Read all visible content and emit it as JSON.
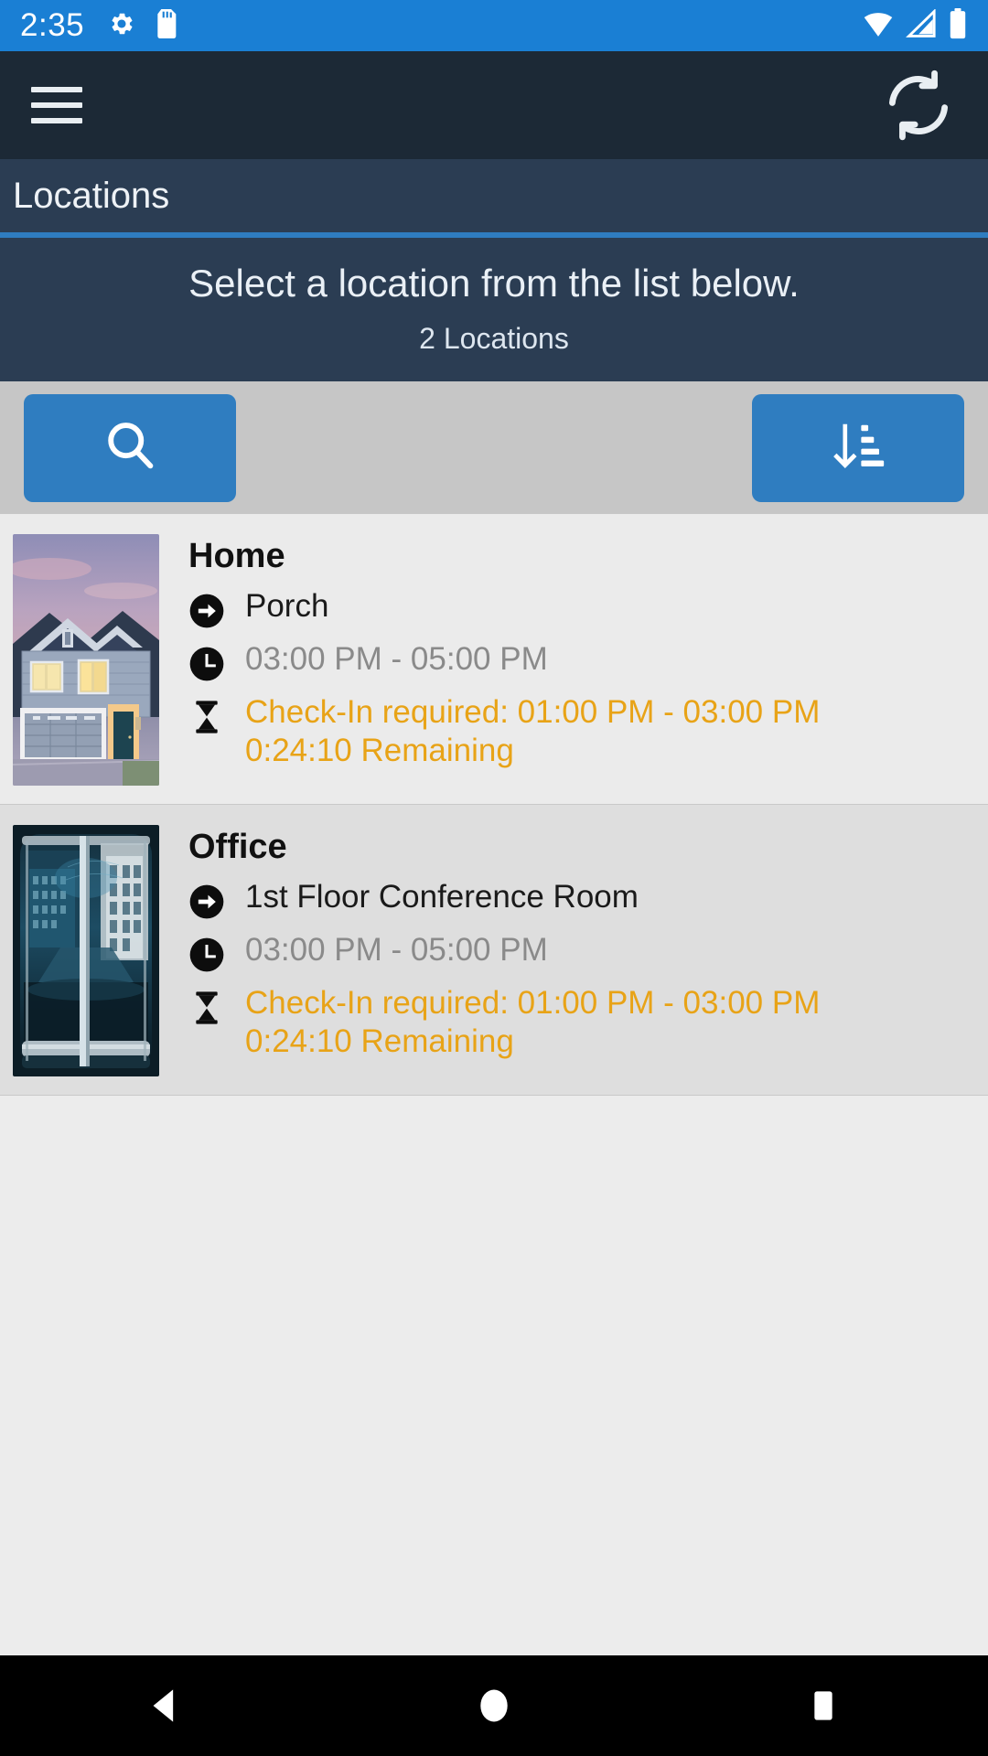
{
  "status_bar": {
    "time": "2:35",
    "left_icons": [
      "gear-icon",
      "sd-card-icon"
    ],
    "right_icons": [
      "wifi-icon",
      "cell-signal-icon",
      "battery-icon"
    ],
    "background_color": "#1a7fd4"
  },
  "app_bar": {
    "menu_icon": "hamburger-menu-icon",
    "refresh_icon": "sync-refresh-icon",
    "background_color": "#1c2936"
  },
  "header": {
    "title": "Locations",
    "accent_color": "#2f7dc0",
    "background_color": "#2b3d53"
  },
  "instruction": {
    "primary": "Select a location from the list below.",
    "count": "2 Locations"
  },
  "toolbar": {
    "search_label": "search-icon",
    "sort_label": "sort-descending-icon",
    "button_color": "#2f7dc0",
    "background_color": "#c6c6c6"
  },
  "locations": [
    {
      "name": "Home",
      "thumbnail": "house-at-dusk-photo",
      "place_icon": "arrow-circle-right-icon",
      "place": "Porch",
      "time_icon": "clock-icon",
      "time_range": "03:00 PM - 05:00 PM",
      "checkin_icon": "hourglass-icon",
      "checkin_required": "Check-In required: 01:00 PM - 03:00 PM",
      "remaining": "0:24:10 Remaining",
      "warn_color": "#e8a317"
    },
    {
      "name": "Office",
      "thumbnail": "revolving-glass-door-photo",
      "place_icon": "arrow-circle-right-icon",
      "place": "1st Floor Conference Room",
      "time_icon": "clock-icon",
      "time_range": "03:00 PM - 05:00 PM",
      "checkin_icon": "hourglass-icon",
      "checkin_required": "Check-In required: 01:00 PM - 03:00 PM",
      "remaining": "0:24:10 Remaining",
      "warn_color": "#e8a317"
    }
  ],
  "nav_bar": {
    "back": "back-triangle-icon",
    "home": "home-circle-icon",
    "recents": "recents-square-icon"
  }
}
